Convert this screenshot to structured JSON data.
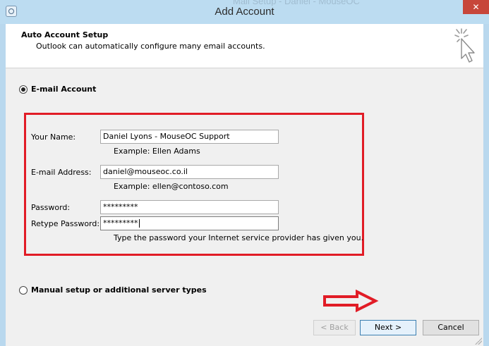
{
  "window": {
    "title": "Add Account",
    "background_text": "Mail Setup - Daniel - MouseOC",
    "close_glyph": "✕"
  },
  "header": {
    "title": "Auto Account Setup",
    "subtitle": "Outlook can automatically configure many email accounts."
  },
  "options": {
    "email_account_label": "E-mail Account",
    "email_account_selected": true,
    "manual_setup_label": "Manual setup or additional server types",
    "manual_setup_selected": false
  },
  "form": {
    "name_label": "Your Name:",
    "name_value": "Daniel Lyons - MouseOC Support",
    "name_example": "Example: Ellen Adams",
    "email_label": "E-mail Address:",
    "email_value": "daniel@mouseoc.co.il",
    "email_example": "Example: ellen@contoso.com",
    "password_label": "Password:",
    "password_value": "*********",
    "retype_label": "Retype Password:",
    "retype_value": "*********",
    "password_hint": "Type the password your Internet service provider has given you."
  },
  "buttons": {
    "back": "< Back",
    "next": "Next >",
    "cancel": "Cancel"
  },
  "icons": {
    "app": "outlook-app-icon",
    "wizard": "magic-cursor-icon",
    "annotation_arrow": "red-arrow-icon"
  },
  "colors": {
    "annotation_red": "#e11c26",
    "titlebar": "#bcdcf1",
    "close_button": "#c7463a"
  }
}
